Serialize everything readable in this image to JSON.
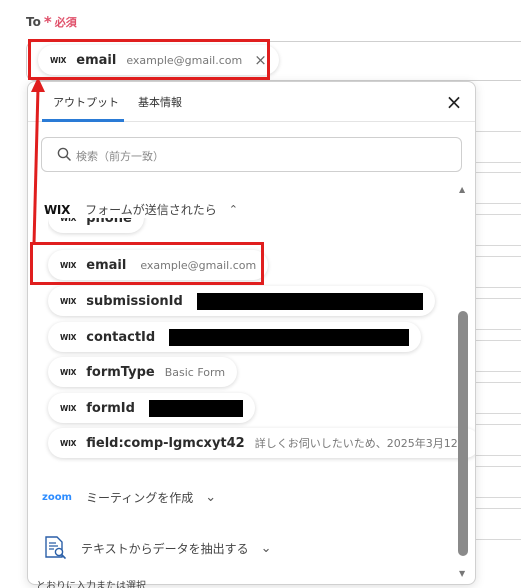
{
  "field": {
    "label": "To",
    "required_star": "*",
    "required_text": "必須"
  },
  "to_chip": {
    "logo": "WIX",
    "key": "email",
    "value": "example@gmail.com",
    "remove_icon": "×"
  },
  "popup": {
    "tabs": [
      {
        "label": "アウトプット"
      },
      {
        "label": "基本情報"
      }
    ],
    "close_icon": "×",
    "search_placeholder": "検索（前方一致）",
    "wix_section": {
      "logo": "WIX",
      "label": "フォームが送信されたら",
      "chevron": "⌃"
    },
    "items": [
      {
        "key": "phone",
        "value": ""
      },
      {
        "key": "email",
        "value": "example@gmail.com"
      },
      {
        "key": "submissionId",
        "value": ""
      },
      {
        "key": "contactId",
        "value": ""
      },
      {
        "key": "formType",
        "value": "Basic Form"
      },
      {
        "key": "formId",
        "value": ""
      },
      {
        "key": "field:comp-lgmcxyt42",
        "value": "詳しくお伺いしたいため、2025年3月12..."
      }
    ],
    "item_logo": "WIX",
    "zoom_section": {
      "logo": "zoom",
      "label": "ミーティングを作成",
      "chevron": "⌄"
    },
    "extract_section": {
      "label": "テキストからデータを抽出する",
      "chevron": "⌄"
    }
  },
  "bottom_text": "とおりに入力または選択",
  "colors": {
    "accent": "#2a7bd6",
    "annotation": "#e01e1e",
    "required": "#e0506a"
  }
}
